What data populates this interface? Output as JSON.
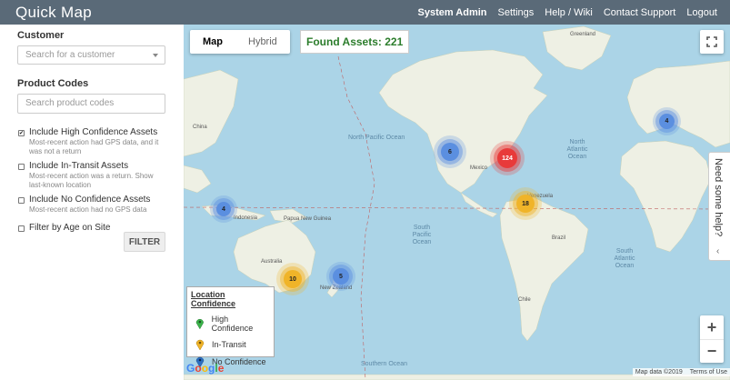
{
  "header": {
    "app_title": "Quick Map",
    "nav": [
      "System Admin",
      "Settings",
      "Help / Wiki",
      "Contact Support",
      "Logout"
    ]
  },
  "sidebar": {
    "customer_label": "Customer",
    "customer_placeholder": "Search for a customer",
    "product_label": "Product Codes",
    "product_placeholder": "Search product codes",
    "options": [
      {
        "title": "Include High Confidence Assets",
        "desc": "Most-recent action had GPS data, and it was not a return",
        "checked": true
      },
      {
        "title": "Include In-Transit Assets",
        "desc": "Most-recent action was a return. Show last-known location",
        "checked": false
      },
      {
        "title": "Include No Confidence Assets",
        "desc": "Most-recent action had no GPS data",
        "checked": false
      },
      {
        "title": "Filter by Age on Site",
        "desc": "",
        "checked": false
      }
    ],
    "filter_button": "FILTER"
  },
  "map": {
    "type_map": "Map",
    "type_hybrid": "Hybrid",
    "found_assets": "Found Assets: 221",
    "help_tab": "Need some help?",
    "help_chevron": "‹",
    "zoom_in": "+",
    "zoom_out": "−",
    "fullscreen_icon": "⛶",
    "google_logo": "Google",
    "attribution": [
      "Map data ©2019",
      "Terms of Use"
    ],
    "legend": {
      "title": "Location Confidence",
      "items": [
        {
          "label": "High Confidence",
          "color": "#3bb34a"
        },
        {
          "label": "In-Transit",
          "color": "#f0b429"
        },
        {
          "label": "No Confidence",
          "color": "#2c6fc2"
        }
      ]
    },
    "clusters": [
      {
        "label": "6",
        "color": "blue"
      },
      {
        "label": "124",
        "color": "red"
      },
      {
        "label": "4",
        "color": "blue"
      },
      {
        "label": "18",
        "color": "yellow"
      },
      {
        "label": "4",
        "color": "blue"
      },
      {
        "label": "10",
        "color": "yellow"
      },
      {
        "label": "5",
        "color": "blue"
      }
    ],
    "ocean_labels": [
      "North Pacific Ocean",
      "North Atlantic Ocean",
      "South Pacific Ocean",
      "South Atlantic Ocean",
      "Southern Ocean"
    ],
    "land_labels": [
      "Greenland",
      "China",
      "Indonesia",
      "Papua New Guinea",
      "Australia",
      "New Zealand",
      "Brazil",
      "Mexico",
      "Venezuela",
      "Chile"
    ]
  }
}
